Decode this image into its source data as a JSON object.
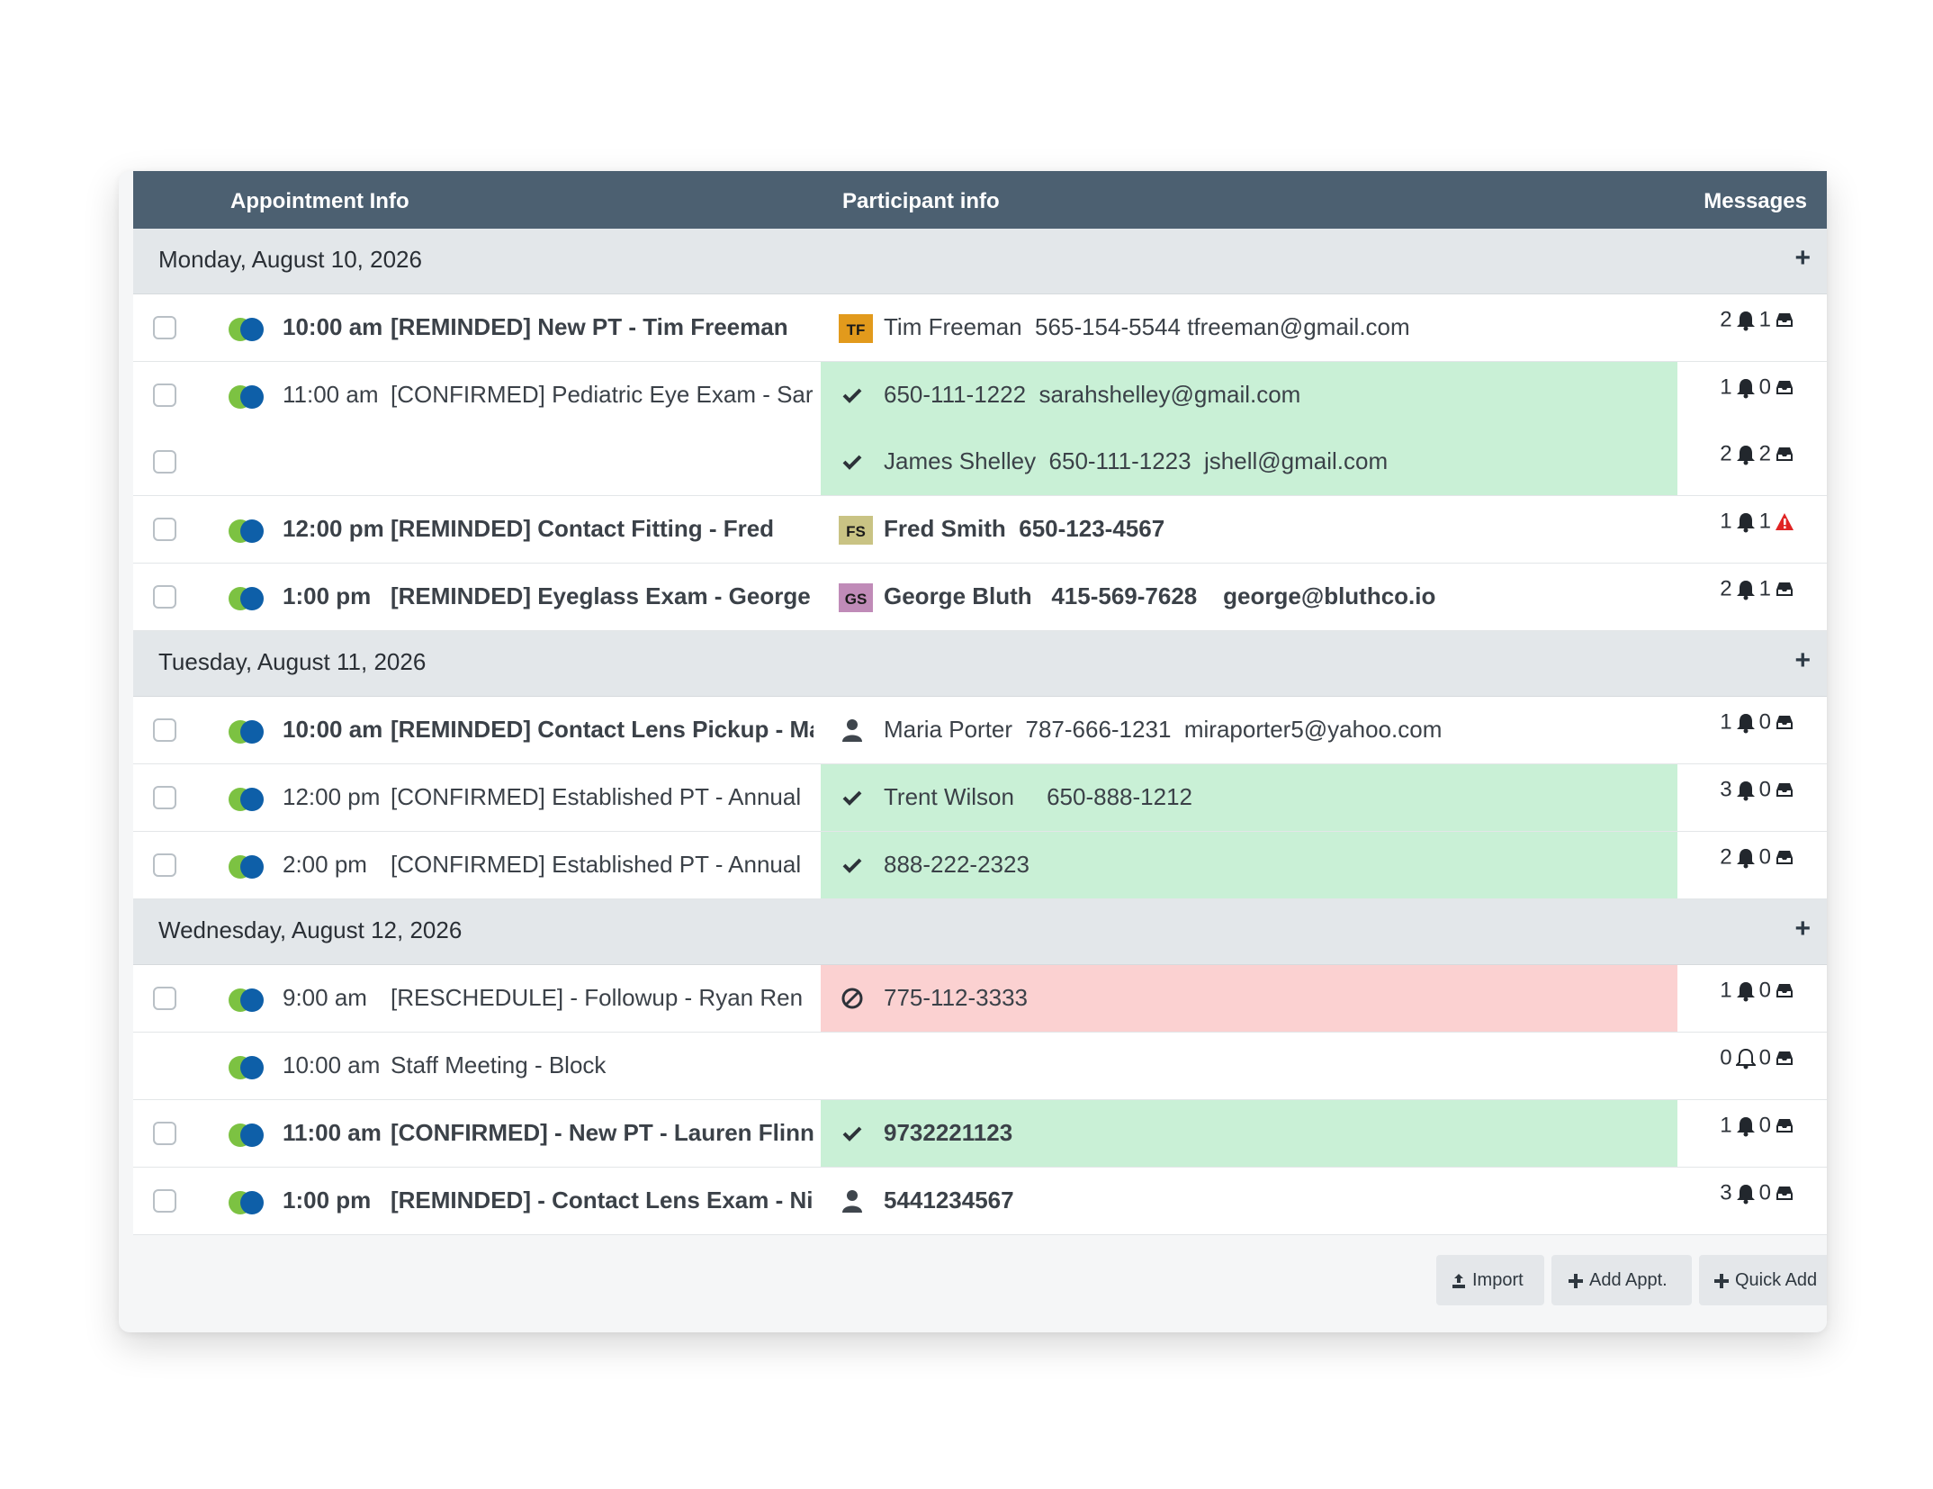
{
  "header": {
    "appointment_info": "Appointment Info",
    "participant_info": "Participant info",
    "messages": "Messages"
  },
  "groups": [
    {
      "date": "Monday, August 10, 2026",
      "plus": "+",
      "rows": [
        {
          "checkbox": true,
          "time": "10:00 am",
          "title": "[REMINDED] New PT - Tim Freeman",
          "bold": true,
          "bg": "white",
          "participants": [
            {
              "icon": "avatar",
              "avatar_text": "TF",
              "avatar_color": "#e29a1c",
              "text": "Tim Freeman  565-154-5544 tfreeman@gmail.com",
              "bold": false
            }
          ],
          "messages": [
            {
              "reminders": "2",
              "bell": "filled",
              "replies": "1",
              "status": "inbox"
            }
          ]
        },
        {
          "checkbox": true,
          "time": "11:00 am",
          "title": "[CONFIRMED] Pediatric Eye Exam - Sar",
          "bold": false,
          "bg": "green",
          "extra_checkbox": true,
          "participants": [
            {
              "icon": "check",
              "text": "650-111-1222  sarahshelley@gmail.com",
              "bold": false
            },
            {
              "icon": "check",
              "text": "James Shelley  650-111-1223  jshell@gmail.com",
              "bold": false
            }
          ],
          "messages": [
            {
              "reminders": "1",
              "bell": "filled",
              "replies": "0",
              "status": "inbox"
            },
            {
              "reminders": "2",
              "bell": "filled",
              "replies": "2",
              "status": "inbox"
            }
          ]
        },
        {
          "checkbox": true,
          "time": "12:00 pm",
          "title": "[REMINDED] Contact Fitting - Fred",
          "bold": true,
          "bg": "white",
          "participants": [
            {
              "icon": "avatar",
              "avatar_text": "FS",
              "avatar_color": "#c9c384",
              "text": "Fred Smith  650-123-4567",
              "bold": true
            }
          ],
          "messages": [
            {
              "reminders": "1",
              "bell": "filled",
              "replies": "1",
              "status": "warning"
            }
          ]
        },
        {
          "checkbox": true,
          "time": "1:00 pm",
          "title": "[REMINDED] Eyeglass Exam - George",
          "bold": true,
          "bg": "white",
          "participants": [
            {
              "icon": "avatar",
              "avatar_text": "GS",
              "avatar_color": "#c08bb8",
              "text": "George Bluth   415-569-7628    george@bluthco.io",
              "bold": true
            }
          ],
          "messages": [
            {
              "reminders": "2",
              "bell": "filled",
              "replies": "1",
              "status": "inbox"
            }
          ]
        }
      ]
    },
    {
      "date": "Tuesday, August 11, 2026",
      "plus": "+",
      "rows": [
        {
          "checkbox": true,
          "time": "10:00 am",
          "title": "[REMINDED] Contact Lens Pickup - Mar",
          "bold": true,
          "bg": "white",
          "participants": [
            {
              "icon": "user",
              "text": "Maria Porter  787-666-1231  miraporter5@yahoo.com",
              "bold": false
            }
          ],
          "messages": [
            {
              "reminders": "1",
              "bell": "filled",
              "replies": "0",
              "status": "inbox"
            }
          ]
        },
        {
          "checkbox": true,
          "time": "12:00 pm",
          "title": "[CONFIRMED] Established PT - Annual",
          "bold": false,
          "bg": "green",
          "participants": [
            {
              "icon": "check",
              "text": "Trent Wilson     650-888-1212",
              "bold": false
            }
          ],
          "messages": [
            {
              "reminders": "3",
              "bell": "filled",
              "replies": "0",
              "status": "inbox"
            }
          ]
        },
        {
          "checkbox": true,
          "time": "2:00 pm",
          "title": "[CONFIRMED] Established PT - Annual",
          "bold": false,
          "bg": "green",
          "participants": [
            {
              "icon": "check",
              "text": "888-222-2323",
              "bold": false
            }
          ],
          "messages": [
            {
              "reminders": "2",
              "bell": "filled",
              "replies": "0",
              "status": "inbox"
            }
          ]
        }
      ]
    },
    {
      "date": "Wednesday, August 12, 2026",
      "plus": "+",
      "rows": [
        {
          "checkbox": true,
          "time": "9:00 am",
          "title": "[RESCHEDULE] - Followup - Ryan Ren",
          "bold": false,
          "bg": "red",
          "participants": [
            {
              "icon": "ban",
              "text": "775-112-3333",
              "bold": false
            }
          ],
          "messages": [
            {
              "reminders": "1",
              "bell": "filled",
              "replies": "0",
              "status": "inbox"
            }
          ]
        },
        {
          "checkbox": false,
          "time": "10:00 am",
          "title": "Staff Meeting - Block",
          "bold": false,
          "bg": "white",
          "participants": [],
          "messages": [
            {
              "reminders": "0",
              "bell": "outline",
              "replies": "0",
              "status": "inbox"
            }
          ]
        },
        {
          "checkbox": true,
          "time": "11:00 am",
          "title": "[CONFIRMED] - New PT - Lauren Flinn",
          "bold": true,
          "bg": "green",
          "participants": [
            {
              "icon": "check",
              "text": "9732221123",
              "bold": true
            }
          ],
          "messages": [
            {
              "reminders": "1",
              "bell": "filled",
              "replies": "0",
              "status": "inbox"
            }
          ]
        },
        {
          "checkbox": true,
          "time": "1:00 pm",
          "title": "[REMINDED] - Contact Lens Exam - Nic",
          "bold": true,
          "bg": "white",
          "participants": [
            {
              "icon": "user",
              "text": "5441234567",
              "bold": true
            }
          ],
          "messages": [
            {
              "reminders": "3",
              "bell": "filled",
              "replies": "0",
              "status": "inbox"
            }
          ]
        }
      ]
    }
  ],
  "footer": {
    "import_label": "Import",
    "add_appt_label": "Add Appt.",
    "quick_add_label": "Quick Add"
  },
  "colors": {
    "header_bg": "#4c6071",
    "date_row_bg": "#e3e7ea",
    "confirmed_bg": "#c9f0d6",
    "reschedule_bg": "#fbd1d1",
    "toggle_green": "#7cc242",
    "toggle_blue": "#0e5fa8",
    "warning_red": "#e02424"
  }
}
